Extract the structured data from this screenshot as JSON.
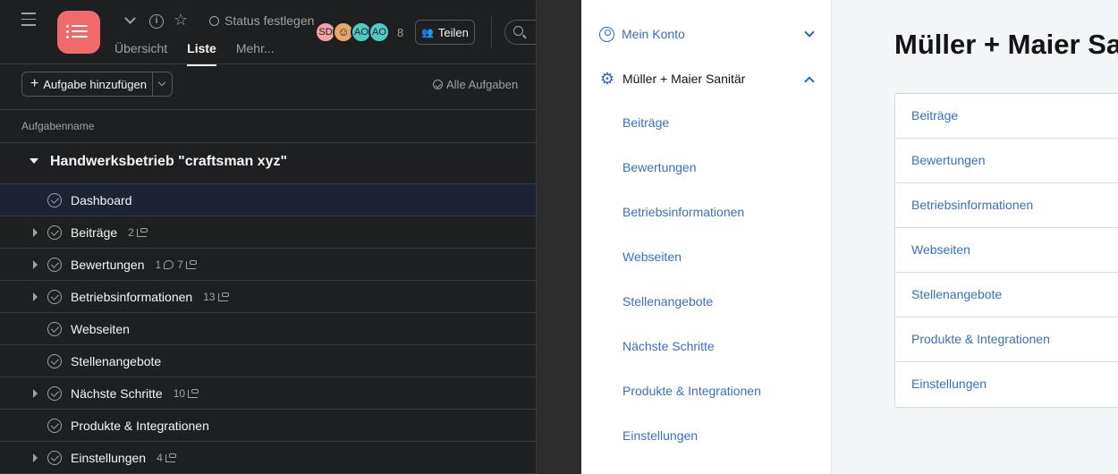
{
  "header": {
    "status_label": "Status festlegen",
    "avatars": [
      {
        "initials": "SD",
        "color": "#f1a3a5"
      },
      {
        "initials": "",
        "color": "#e8a76a"
      },
      {
        "initials": "AO",
        "color": "#4ecbc4"
      },
      {
        "initials": "AO",
        "color": "#4ecbc4"
      }
    ],
    "member_count": "8",
    "share_label": "Teilen"
  },
  "tabs": [
    {
      "label": "Übersicht",
      "active": false
    },
    {
      "label": "Liste",
      "active": true
    },
    {
      "label": "Mehr..."
    }
  ],
  "toolbar": {
    "add_task_label": "Aufgabe hinzufügen",
    "all_tasks_label": "Alle Aufgaben"
  },
  "list": {
    "column_header": "Aufgabenname",
    "section_title": "Handwerksbetrieb \"craftsman xyz\"",
    "rows": [
      {
        "name": "Dashboard",
        "expandable": false,
        "selected": true,
        "comments": "",
        "subtasks": ""
      },
      {
        "name": "Beiträge",
        "expandable": true,
        "comments": "",
        "subtasks": "2"
      },
      {
        "name": "Bewertungen",
        "expandable": true,
        "comments": "1",
        "subtasks": "7"
      },
      {
        "name": "Betriebsinformationen",
        "expandable": true,
        "comments": "",
        "subtasks": "13"
      },
      {
        "name": "Webseiten",
        "expandable": false,
        "comments": "",
        "subtasks": ""
      },
      {
        "name": "Stellenangebote",
        "expandable": false,
        "comments": "",
        "subtasks": ""
      },
      {
        "name": "Nächste Schritte",
        "expandable": true,
        "comments": "",
        "subtasks": "10"
      },
      {
        "name": "Produkte & Integrationen",
        "expandable": false,
        "comments": "",
        "subtasks": ""
      },
      {
        "name": "Einstellungen",
        "expandable": true,
        "comments": "",
        "subtasks": "4"
      }
    ]
  },
  "settings_sidebar": {
    "account_label": "Mein Konto",
    "company_label": "Müller + Maier Sanitär",
    "items": [
      "Beiträge",
      "Bewertungen",
      "Betriebsinformationen",
      "Webseiten",
      "Stellenangebote",
      "Nächste Schritte",
      "Produkte & Integrationen",
      "Einstellungen"
    ]
  },
  "content": {
    "title": "Müller + Maier Sanitär",
    "items": [
      "Beiträge",
      "Bewertungen",
      "Betriebsinformationen",
      "Webseiten",
      "Stellenangebote",
      "Produkte & Integrationen",
      "Einstellungen"
    ]
  },
  "colors": {
    "project_icon": "#f06a6a",
    "link_blue": "#3b6fc0",
    "dark_bg": "#1e1f21"
  }
}
